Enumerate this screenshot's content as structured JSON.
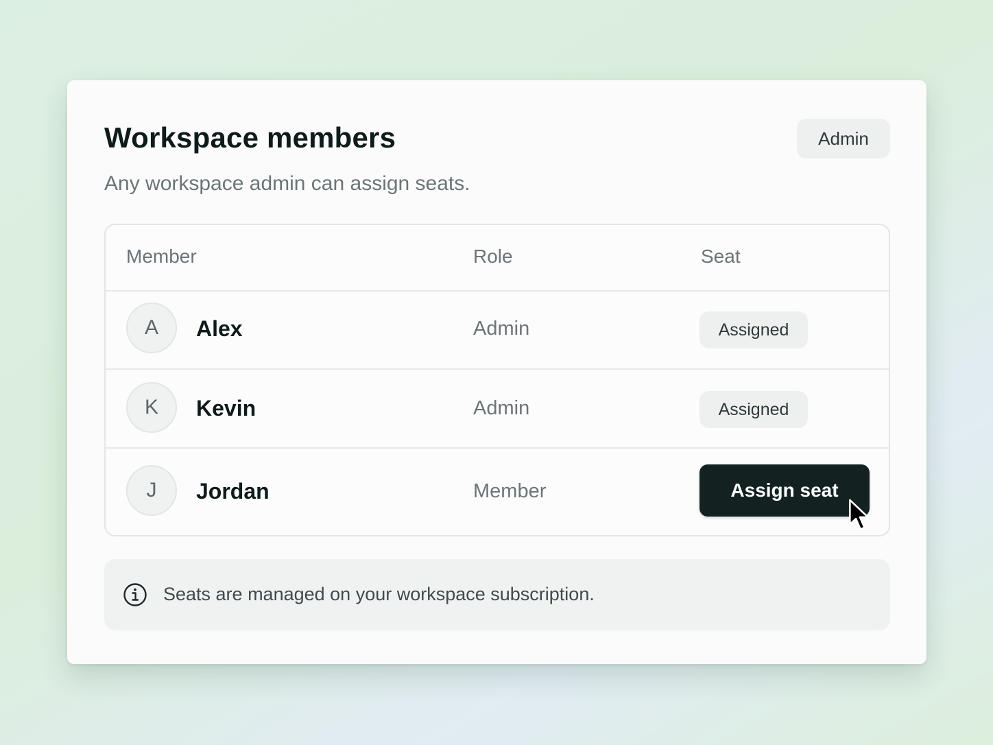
{
  "header": {
    "title": "Workspace members",
    "subtitle": "Any workspace admin can assign seats.",
    "current_role": "Admin"
  },
  "table": {
    "columns": [
      "Member",
      "Role",
      "Seat"
    ],
    "rows": [
      {
        "initial": "A",
        "name": "Alex",
        "role": "Admin",
        "seat": "Assigned"
      },
      {
        "initial": "K",
        "name": "Kevin",
        "role": "Admin",
        "seat": "Assigned"
      },
      {
        "initial": "J",
        "name": "Jordan",
        "role": "Member",
        "seat": "Assign seat"
      }
    ]
  },
  "note": {
    "icon": "info-icon",
    "text": "Seats are managed on your workspace subscription."
  },
  "colors": {
    "primary_button": "#132221",
    "badge_bg": "#eeefef",
    "muted_text": "#6b7579"
  }
}
